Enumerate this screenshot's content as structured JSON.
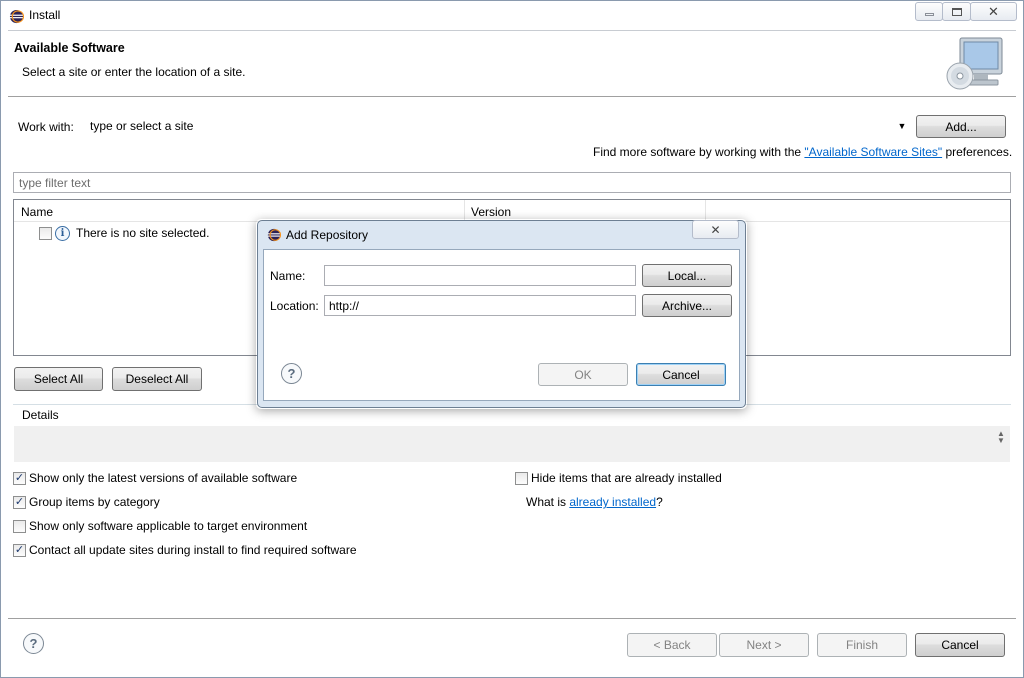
{
  "window": {
    "title": "Install"
  },
  "header": {
    "title": "Available Software",
    "subtitle": "Select a site or enter the location of a site."
  },
  "work_with": {
    "label": "Work with:",
    "value": "type or select a site",
    "add_label": "Add..."
  },
  "find_more": {
    "prefix": "Find more software by working with the ",
    "link": "\"Available Software Sites\"",
    "suffix": " preferences."
  },
  "filter": {
    "placeholder": "type filter text"
  },
  "table": {
    "columns": [
      "Name",
      "Version"
    ],
    "message": "There is no site selected."
  },
  "selection_buttons": {
    "select_all": "Select All",
    "deselect_all": "Deselect All"
  },
  "details": {
    "label": "Details"
  },
  "options": {
    "show_latest": {
      "label": "Show only the latest versions of available software",
      "checked": true
    },
    "group_by_category": {
      "label": "Group items by category",
      "checked": true
    },
    "show_applicable": {
      "label": "Show only software applicable to target environment",
      "checked": false
    },
    "contact_all": {
      "label": "Contact all update sites during install to find required software",
      "checked": true
    },
    "hide_installed": {
      "label": "Hide items that are already installed",
      "checked": false
    },
    "what_is_prefix": "What is ",
    "already_installed_link": "already installed",
    "what_is_suffix": "?"
  },
  "footer": {
    "back": "< Back",
    "next": "Next >",
    "finish": "Finish",
    "cancel": "Cancel"
  },
  "dialog": {
    "title": "Add Repository",
    "name_label": "Name:",
    "name_value": "",
    "location_label": "Location:",
    "location_value": "http://",
    "local_button": "Local...",
    "archive_button": "Archive...",
    "ok": "OK",
    "cancel": "Cancel"
  }
}
